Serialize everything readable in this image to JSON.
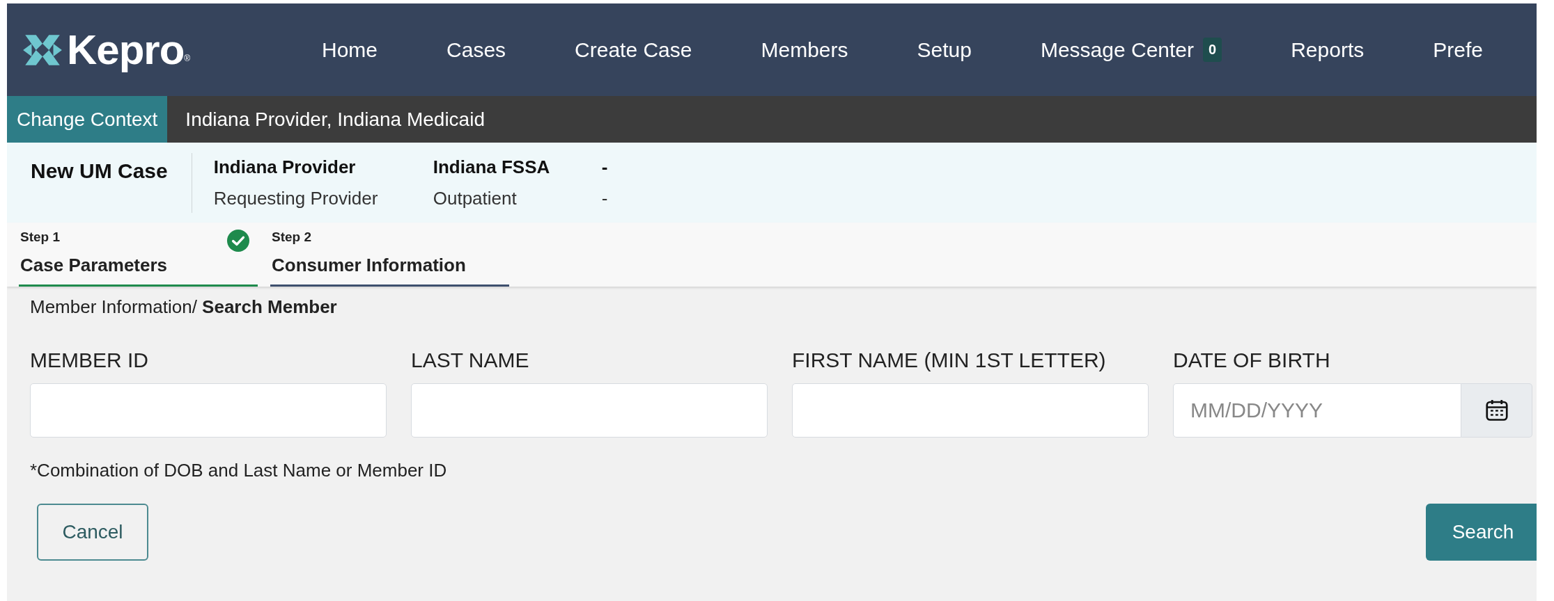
{
  "brand": {
    "name": "Kepro",
    "mark": "®"
  },
  "nav": [
    {
      "label": "Home"
    },
    {
      "label": "Cases"
    },
    {
      "label": "Create Case"
    },
    {
      "label": "Members"
    },
    {
      "label": "Setup"
    },
    {
      "label": "Message Center",
      "badge": "0"
    },
    {
      "label": "Reports"
    },
    {
      "label": "Prefe"
    }
  ],
  "context": {
    "button": "Change Context",
    "value": "Indiana Provider, Indiana Medicaid"
  },
  "case_header": {
    "title": "New UM Case",
    "columns": [
      {
        "primary": "Indiana Provider",
        "secondary": "Requesting Provider"
      },
      {
        "primary": "Indiana FSSA",
        "secondary": "Outpatient"
      },
      {
        "primary": "-",
        "secondary": "-"
      }
    ]
  },
  "steps": [
    {
      "step": "Step 1",
      "label": "Case Parameters",
      "completed": true,
      "selected": false
    },
    {
      "step": "Step 2",
      "label": "Consumer Information",
      "completed": false,
      "selected": true
    }
  ],
  "breadcrumb": "Member Information/ **Search Member**",
  "fields": [
    {
      "label": "MEMBER ID",
      "kind": "text"
    },
    {
      "label": "LAST NAME",
      "kind": "text"
    },
    {
      "label": "FIRST NAME (MIN 1ST LETTER)",
      "kind": "text"
    },
    {
      "label": "DATE OF BIRTH",
      "kind": "date",
      "placeholder": "MM/DD/YYYY"
    }
  ],
  "note": "*Combination of DOB and Last Name or Member ID",
  "buttons": [
    {
      "label": "Cancel",
      "kind": "secondary"
    },
    {
      "label": "Search",
      "kind": "primary"
    }
  ]
}
